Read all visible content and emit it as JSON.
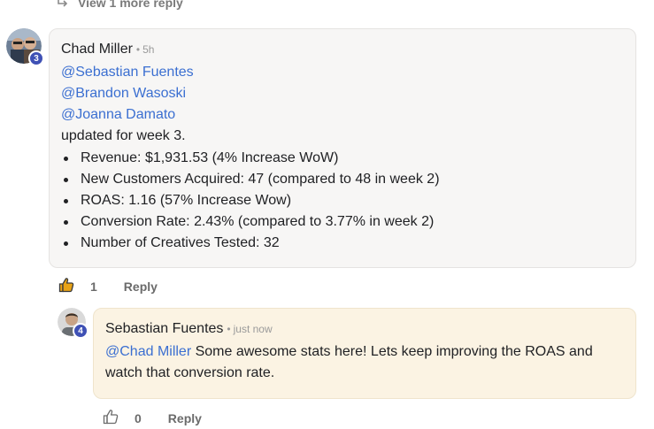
{
  "thread": {
    "view_more_label": "View 1 more reply"
  },
  "comment": {
    "author": "Chad Miller",
    "separator": "•",
    "time": "5h",
    "avatar_badge": "3",
    "mentions": [
      "@Sebastian Fuentes",
      "@Brandon Wasoski",
      "@Joanna Damato"
    ],
    "intro": "updated for week 3.",
    "bullets": [
      "Revenue: $1,931.53 (4% Increase WoW)",
      "New Customers Acquired: 47 (compared to 48 in week 2)",
      "ROAS: 1.16 (57% Increase Wow)",
      "Conversion Rate: 2.43% (compared to 3.77% in week 2)",
      "Number of Creatives Tested: 32"
    ],
    "like_count": "1",
    "reply_label": "Reply",
    "liked": true
  },
  "reply": {
    "author": "Sebastian Fuentes",
    "separator": "•",
    "time": "just now",
    "avatar_badge": "4",
    "mention": "@Chad Miller",
    "text_line1": " Some awesome stats here! Lets keep improving the ROAS and",
    "text_line2": "watch that conversion rate.",
    "like_count": "0",
    "reply_label": "Reply",
    "liked": false
  },
  "colors": {
    "mention": "#3b6fd1",
    "badge": "#3f51b5",
    "main_bubble": "#f7f6f5",
    "reply_bubble": "#fbf3e3",
    "like_active": "#e8a317"
  }
}
